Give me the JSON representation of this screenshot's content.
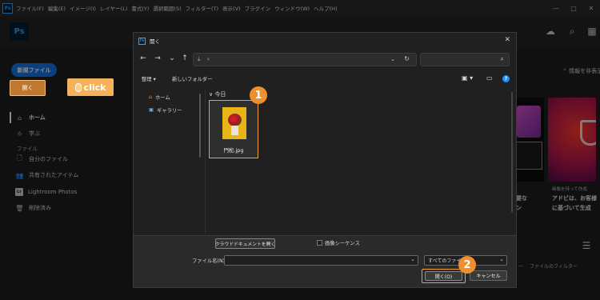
{
  "menubar": {
    "app_badge": "Ps",
    "items": [
      "ファイル(F)",
      "編集(E)",
      "イメージ(I)",
      "レイヤー(L)",
      "書式(Y)",
      "選択範囲(S)",
      "フィルター(T)",
      "表示(V)",
      "プラグイン",
      "ウィンドウ(W)",
      "ヘルプ(H)"
    ],
    "controls": [
      "—",
      "□",
      "✕"
    ]
  },
  "header": {
    "logo": "Ps",
    "icons": [
      "cloud-icon",
      "search-icon",
      "apps-grid-icon"
    ]
  },
  "sidebar": {
    "new_file": "新規ファイル",
    "open": "開く",
    "click_tag": "click",
    "items": [
      {
        "icon": "⌂",
        "label": "ホーム"
      },
      {
        "icon": "☼",
        "label": "学ぶ"
      }
    ],
    "section": "ファイル",
    "file_items": [
      {
        "icon": "🗋",
        "label": "自分のファイル"
      },
      {
        "icon": "👥",
        "label": "共有されたアイテム"
      },
      {
        "icon": "Lr",
        "label": "Lightroom Photos"
      },
      {
        "icon": "🗑",
        "label": "削除済み"
      }
    ]
  },
  "background": {
    "info_label": "情報を非表示",
    "card_text_1a": "要な",
    "card_text_1b": "ン",
    "card_caption": "画像を持って作成",
    "card_title_1": "アドビは、お客様",
    "card_title_2": "に基づいて生成",
    "filter_text_a": "ー",
    "filter_text_b": "ファイルのフィルター"
  },
  "dialog": {
    "title": "開く",
    "close": "✕",
    "nav": {
      "back": "←",
      "forward": "→",
      "history": "⌄",
      "up": "↑",
      "path_separator": "›",
      "dropdown": "⌄",
      "refresh": "↻",
      "search_icon": "⌕"
    },
    "toolbar": {
      "organize": "整理 ▾",
      "new_folder": "新しいフォルダー",
      "view": "▣ ▾",
      "help": "?"
    },
    "quick_access": [
      {
        "icon": "⌂",
        "label": "ホーム"
      },
      {
        "icon": "▣",
        "label": "ギャラリー"
      }
    ],
    "group_header": "∨ 今日",
    "file": {
      "name": "門松.jpg"
    },
    "footer": {
      "cloud_doc_button": "クラウドドキュメントを開く",
      "image_sequence": "画像シーケンス",
      "filename_label": "ファイル名(N):",
      "filename_value": "",
      "file_type": "すべてのファイル",
      "open_button": "開く(O)",
      "cancel_button": "キャンセル"
    }
  },
  "steps": [
    "1",
    "2"
  ],
  "colors": {
    "accent_orange": "#ef8f2f",
    "adobe_blue": "#1473e6",
    "ps_blue": "#31a8ff"
  }
}
